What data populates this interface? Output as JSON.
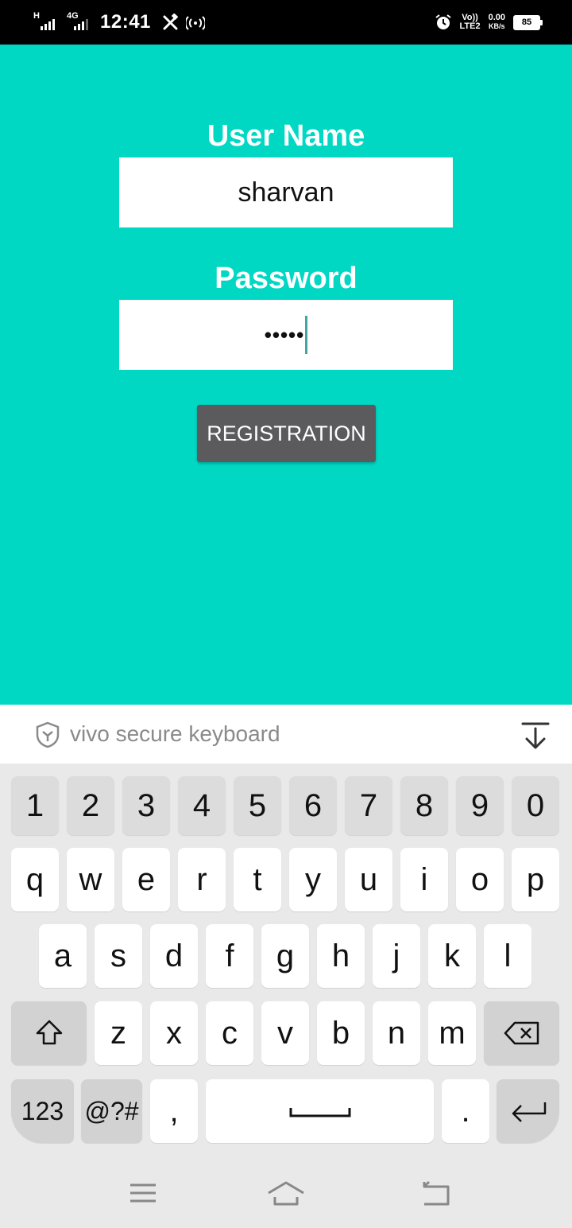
{
  "status_bar": {
    "network_left_1": "H",
    "network_left_2": "4G",
    "time": "12:41",
    "volte_top": "Vo))",
    "volte_bottom": "LTE2",
    "speed_value": "0.00",
    "speed_unit": "KB/s",
    "battery": "85",
    "icons": [
      "signal-icon",
      "signal-icon",
      "tools-icon",
      "hotspot-icon",
      "alarm-icon",
      "battery-icon"
    ]
  },
  "form": {
    "username_label": "User Name",
    "username_value": "sharvan",
    "password_label": "Password",
    "password_value": "•••••",
    "register_label": "REGISTRATION"
  },
  "keyboard": {
    "title": "vivo secure keyboard",
    "row_numbers": [
      "1",
      "2",
      "3",
      "4",
      "5",
      "6",
      "7",
      "8",
      "9",
      "0"
    ],
    "row_q": [
      "q",
      "w",
      "e",
      "r",
      "t",
      "y",
      "u",
      "i",
      "o",
      "p"
    ],
    "row_a": [
      "a",
      "s",
      "d",
      "f",
      "g",
      "h",
      "j",
      "k",
      "l"
    ],
    "row_z": [
      "z",
      "x",
      "c",
      "v",
      "b",
      "n",
      "m"
    ],
    "key_123": "123",
    "key_symbols": "@?#",
    "key_comma": ",",
    "key_period": "."
  },
  "colors": {
    "background": "#00d8c4",
    "button": "#5b5b5e",
    "keyboard_bg": "#e9e9e9"
  }
}
